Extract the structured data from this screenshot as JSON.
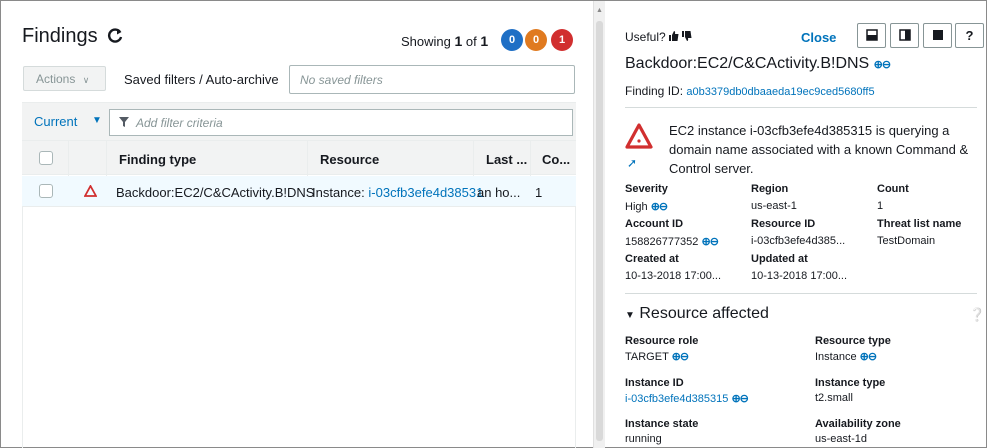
{
  "findings": {
    "title": "Findings",
    "showing_prefix": "Showing",
    "showing_current": "1",
    "showing_of": "of",
    "showing_total": "1",
    "badges": {
      "low": "0",
      "medium": "0",
      "high": "1"
    },
    "colors": {
      "blue": "#1f6fc5",
      "orange": "#e07a1f",
      "red": "#d12f2f",
      "link": "#0073bb"
    }
  },
  "toolbar": {
    "actions_label": "Actions",
    "saved_filters_label": "Saved filters / Auto-archive",
    "saved_filters_placeholder": "No saved filters",
    "current_label": "Current",
    "filter_placeholder": "Add filter criteria"
  },
  "table": {
    "columns": [
      "Finding type",
      "Resource",
      "Last ...",
      "Co..."
    ],
    "rows": [
      {
        "finding_type": "Backdoor:EC2/C&CActivity.B!DNS",
        "resource_prefix": "Instance:",
        "resource_id": "i-03cfb3efe4d38531",
        "last_seen": "an ho...",
        "count": "1"
      }
    ]
  },
  "detail": {
    "useful_label": "Useful?",
    "close_label": "Close",
    "help_label": "?",
    "title": "Backdoor:EC2/C&CActivity.B!DNS",
    "finding_id_label": "Finding ID:",
    "finding_id": "a0b3379db0dbaaeda19ec9ced5680ff5",
    "description": "EC2 instance i-03cfb3efe4d385315 is querying a domain name associated with a known Command & Control server.",
    "fields": {
      "severity_label": "Severity",
      "severity": "High",
      "region_label": "Region",
      "region": "us-east-1",
      "count_label": "Count",
      "count": "1",
      "account_label": "Account ID",
      "account": "158826777352",
      "resource_label": "Resource ID",
      "resource": "i-03cfb3efe4d385...",
      "threat_label": "Threat list name",
      "threat": "TestDomain",
      "created_label": "Created at",
      "created": "10-13-2018 17:00...",
      "updated_label": "Updated at",
      "updated": "10-13-2018 17:00..."
    },
    "resource_section": {
      "title": "Resource affected",
      "role_label": "Resource role",
      "role": "TARGET",
      "type_label": "Resource type",
      "type": "Instance",
      "instance_id_label": "Instance ID",
      "instance_id": "i-03cfb3efe4d385315",
      "instance_type_label": "Instance type",
      "instance_type": "t2.small",
      "state_label": "Instance state",
      "state": "running",
      "az_label": "Availability zone",
      "az": "us-east-1d"
    }
  }
}
